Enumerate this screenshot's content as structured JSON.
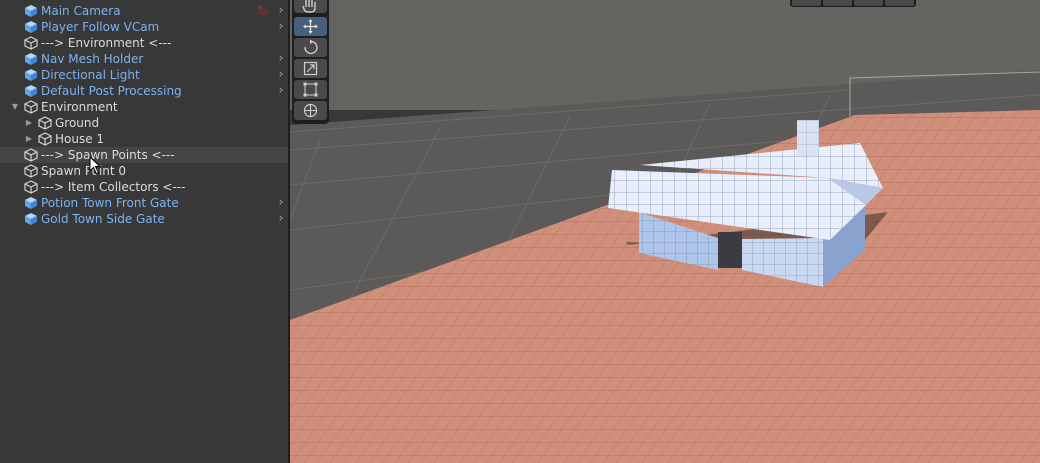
{
  "hierarchy": {
    "items": [
      {
        "label": "Main Camera",
        "kind": "prefab",
        "depth": 0,
        "fold": "",
        "chevron": true,
        "extra": "camera-gizmo-icon"
      },
      {
        "label": "Player Follow VCam",
        "kind": "prefab",
        "depth": 0,
        "fold": "",
        "chevron": true
      },
      {
        "label": "---> Environment <---",
        "kind": "plain",
        "depth": 0,
        "fold": "",
        "chevron": false
      },
      {
        "label": "Nav Mesh Holder",
        "kind": "prefab",
        "depth": 0,
        "fold": "",
        "chevron": true
      },
      {
        "label": "Directional Light",
        "kind": "prefab",
        "depth": 0,
        "fold": "",
        "chevron": true
      },
      {
        "label": "Default Post Processing",
        "kind": "prefab",
        "depth": 0,
        "fold": "",
        "chevron": true
      },
      {
        "label": "Environment",
        "kind": "plain",
        "depth": 0,
        "fold": "expanded",
        "chevron": false
      },
      {
        "label": "Ground",
        "kind": "plain",
        "depth": 1,
        "fold": "collapsed",
        "chevron": false
      },
      {
        "label": "House 1",
        "kind": "plain",
        "depth": 1,
        "fold": "collapsed",
        "chevron": false
      },
      {
        "label": "---> Spawn Points <---",
        "kind": "plain",
        "depth": 0,
        "fold": "",
        "chevron": false,
        "hover": true
      },
      {
        "label": "Spawn Point 0",
        "kind": "plain",
        "depth": 0,
        "fold": "",
        "chevron": false
      },
      {
        "label": "---> Item Collectors <---",
        "kind": "plain",
        "depth": 0,
        "fold": "",
        "chevron": false
      },
      {
        "label": "Potion Town Front Gate",
        "kind": "prefab",
        "depth": 0,
        "fold": "",
        "chevron": true
      },
      {
        "label": "Gold Town Side Gate",
        "kind": "prefab",
        "depth": 0,
        "fold": "",
        "chevron": true
      }
    ]
  },
  "scene_tools": {
    "tools": [
      {
        "name": "hand-tool",
        "icon": "hand-icon",
        "active": false
      },
      {
        "name": "move-tool",
        "icon": "move-arrows-icon",
        "active": true
      },
      {
        "name": "rotate-tool",
        "icon": "rotate-icon",
        "active": false
      },
      {
        "name": "scale-tool",
        "icon": "scale-icon",
        "active": false
      },
      {
        "name": "rect-tool",
        "icon": "rect-transform-icon",
        "active": false
      },
      {
        "name": "transform-tool",
        "icon": "transform-gizmo-icon",
        "active": false
      }
    ]
  },
  "orientation_buttons": [
    "orientation-view-icon",
    "orientation-pivot-icon",
    "orientation-local-icon",
    "orientation-global-icon"
  ],
  "colors": {
    "prefab_text": "#7cb3f2",
    "plain_text": "#dcdcdc",
    "panel_bg": "#383838",
    "sky": "#666460",
    "grid_floor": "#5c5a58",
    "terrain": "#cf8f7a",
    "house_wall": "#aec4e8",
    "house_door": "#3b3b42",
    "active_tool": "#46607c"
  }
}
